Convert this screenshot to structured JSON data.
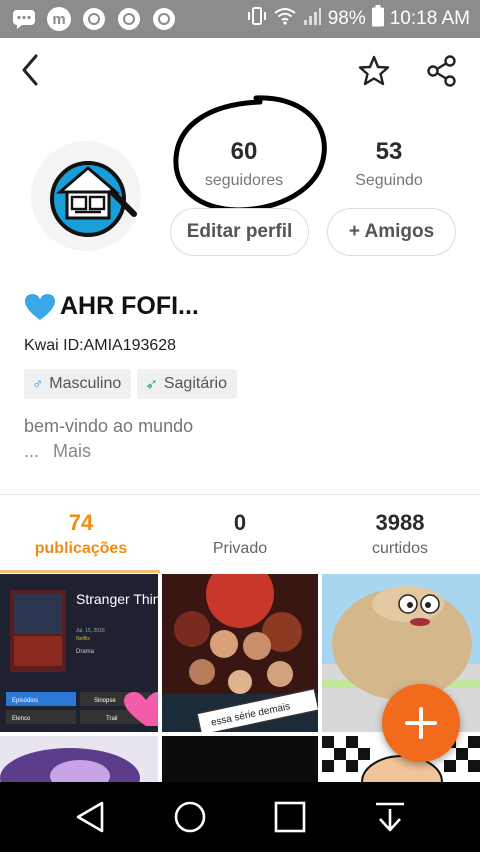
{
  "status_bar": {
    "battery": "98%",
    "time": "10:18 AM",
    "left_icons": [
      "chat-icon",
      "m-app-icon",
      "chrome-icon",
      "chrome-icon",
      "chrome-icon"
    ]
  },
  "profile": {
    "followers_count": "60",
    "followers_label": "seguidores",
    "following_count": "53",
    "following_label": "Seguindo",
    "edit_button": "Editar perfil",
    "friends_button": "+ Amigos",
    "name": "AHR FOFI...",
    "kwai_id": "Kwai ID:AMIA193628",
    "tags": [
      {
        "icon": "♂",
        "label": "Masculino"
      },
      {
        "icon": "➶",
        "label": "Sagitário"
      }
    ],
    "bio": "bem-vindo ao mundo",
    "more_dots": "...",
    "more_label": "Mais"
  },
  "tabs": [
    {
      "count": "74",
      "label": "publicações"
    },
    {
      "count": "0",
      "label": "Privado"
    },
    {
      "count": "3988",
      "label": "curtidos"
    }
  ],
  "thumb1": {
    "title": "Stranger Things",
    "sub1": "Jul. 15, 2016",
    "sub2": "Netflix",
    "genre": "Drama",
    "btn_episodes": "Episódios",
    "btn_synopsis": "Sinopse",
    "btn_cast": "Elenco",
    "btn_trailer": "Trail"
  },
  "thumb2": {
    "caption": "essa série demais"
  },
  "colors": {
    "accent_orange": "#f18c12",
    "fab_orange": "#f26a1b",
    "heart_blue": "#3aa7e8",
    "status_bar_gray": "#8c8c8c"
  }
}
